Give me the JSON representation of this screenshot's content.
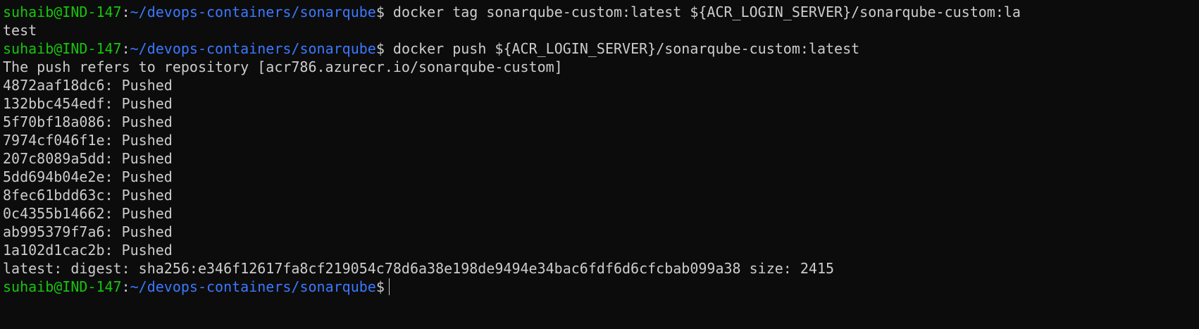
{
  "prompt": {
    "user_host": "suhaib@IND-147",
    "path": "~/devops-containers/sonarqube",
    "symbol": "$"
  },
  "commands": {
    "tag_cmd_part1": " docker tag sonarqube-custom:latest ${ACR_LOGIN_SERVER}/sonarqube-custom:la",
    "tag_cmd_part2": "test",
    "push_cmd": " docker push ${ACR_LOGIN_SERVER}/sonarqube-custom:latest"
  },
  "output": {
    "push_refers": "The push refers to repository [acr786.azurecr.io/sonarqube-custom]",
    "layers": [
      "4872aaf18dc6: Pushed",
      "132bbc454edf: Pushed",
      "5f70bf18a086: Pushed",
      "7974cf046f1e: Pushed",
      "207c8089a5dd: Pushed",
      "5dd694b04e2e: Pushed",
      "8fec61bdd63c: Pushed",
      "0c4355b14662: Pushed",
      "ab995379f7a6: Pushed",
      "1a102d1cac2b: Pushed"
    ],
    "digest": "latest: digest: sha256:e346f12617fa8cf219054c78d6a38e198de9494e34bac6fdf6d6cfcbab099a38 size: 2415"
  },
  "colors": {
    "background": "#0c0c0c",
    "user_host": "#16c60c",
    "path": "#3b78ff",
    "text": "#cccccc"
  }
}
